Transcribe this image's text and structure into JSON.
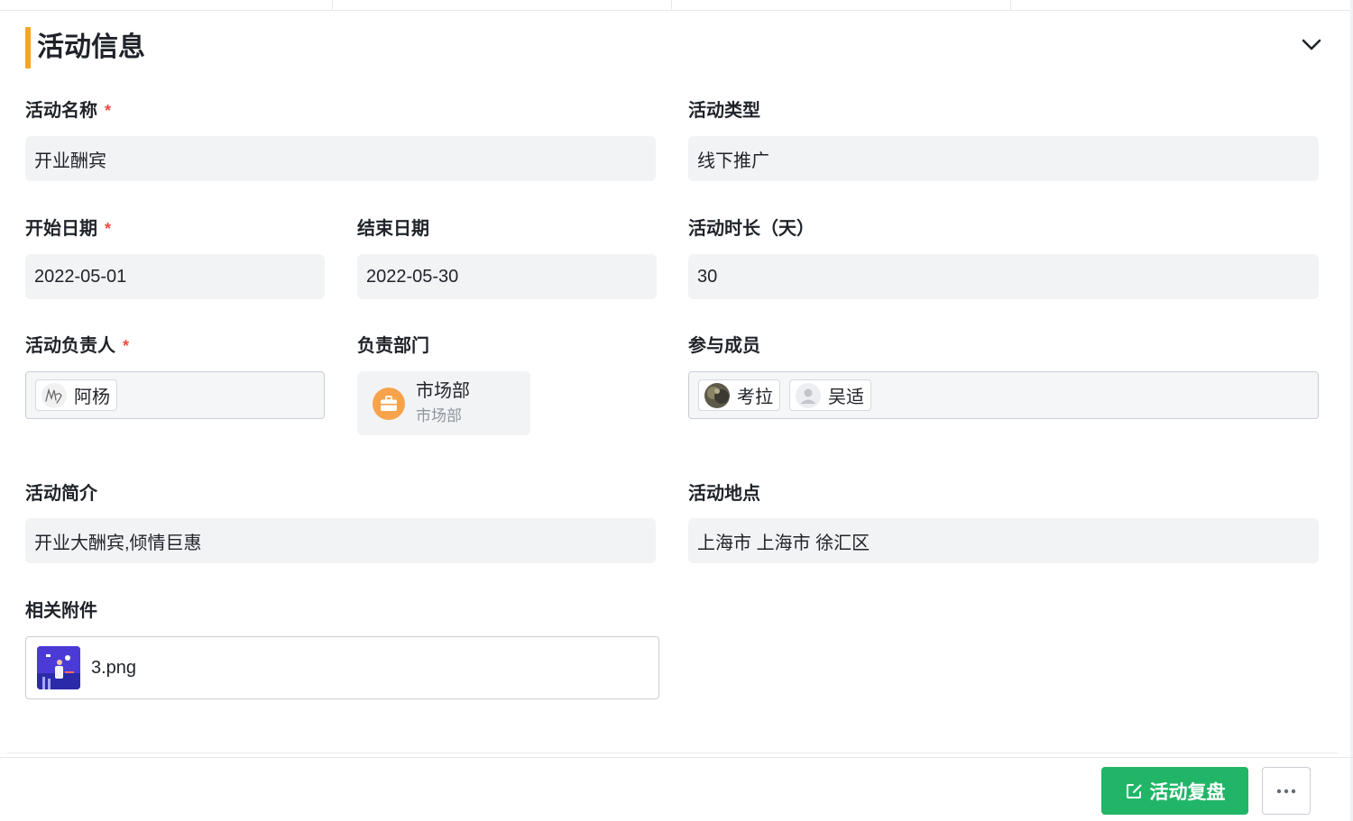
{
  "section": {
    "title": "活动信息",
    "accent_color": "#f5a623",
    "collapse_icon": "chevron-down-icon"
  },
  "fields": {
    "activity_name": {
      "label": "活动名称",
      "required_mark": "*",
      "value": "开业酬宾"
    },
    "activity_type": {
      "label": "活动类型",
      "value": "线下推广"
    },
    "start_date": {
      "label": "开始日期",
      "required_mark": "*",
      "value": "2022-05-01"
    },
    "end_date": {
      "label": "结束日期",
      "value": "2022-05-30"
    },
    "duration": {
      "label": "活动时长（天）",
      "value": "30"
    },
    "owner": {
      "label": "活动负责人",
      "required_mark": "*",
      "user": {
        "name": "阿杨",
        "avatar_icon": "signature-avatar-icon"
      }
    },
    "department": {
      "label": "负责部门",
      "name": "市场部",
      "path": "市场部",
      "icon": "briefcase-icon"
    },
    "members": {
      "label": "参与成员",
      "users": [
        {
          "name": "考拉",
          "avatar_icon": "photo-avatar-icon"
        },
        {
          "name": "吴适",
          "avatar_icon": "default-user-icon"
        }
      ]
    },
    "summary": {
      "label": "活动简介",
      "value": "开业大酬宾,倾情巨惠"
    },
    "location": {
      "label": "活动地点",
      "value": "上海市 上海市 徐汇区"
    },
    "attachments": {
      "label": "相关附件",
      "files": [
        {
          "name": "3.png",
          "icon": "image-thumbnail-icon"
        }
      ]
    }
  },
  "footer": {
    "primary_button": {
      "label": "活动复盘",
      "icon": "edit-icon",
      "color": "#21b667"
    },
    "more_button": {
      "icon": "more-dots-icon"
    }
  }
}
